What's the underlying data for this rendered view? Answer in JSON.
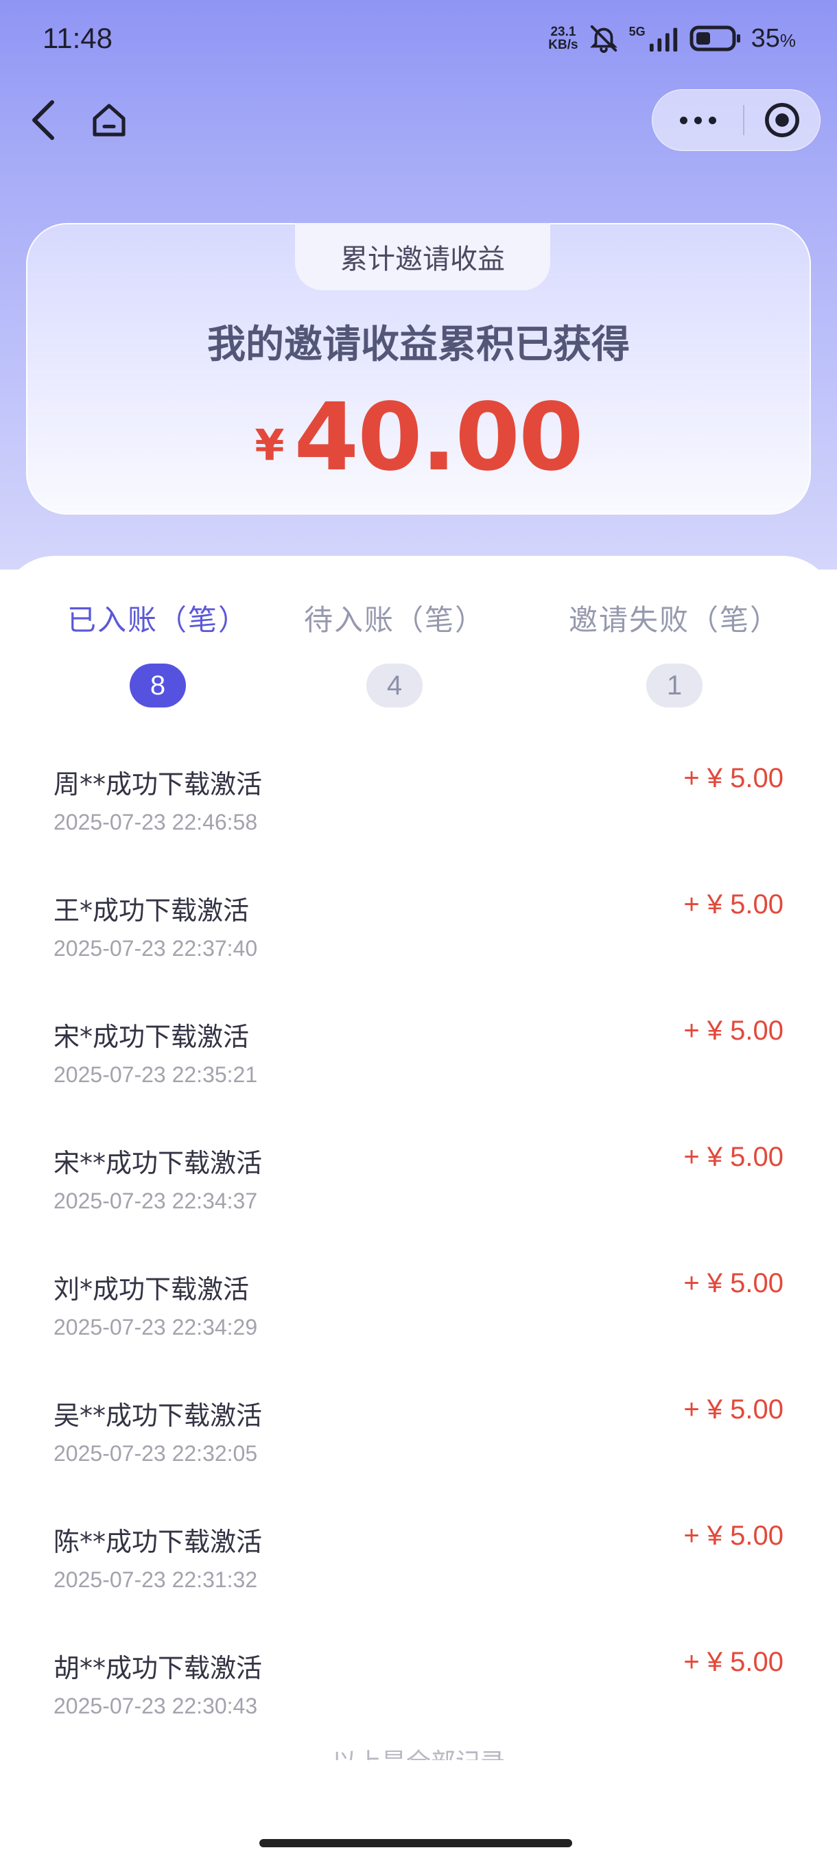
{
  "status_bar": {
    "time": "11:48",
    "net_speed_value": "23.1",
    "net_speed_unit": "KB/s",
    "network_type": "5G",
    "battery_percent": "35",
    "battery_unit": "%",
    "icons": [
      "bell-muted-icon",
      "signal-icon",
      "battery-icon"
    ]
  },
  "nav": {
    "back_icon": "chevron-left-icon",
    "home_icon": "home-icon",
    "more_icon": "more-dots-icon",
    "close_icon": "target-circle-icon"
  },
  "earnings_card": {
    "tag": "累计邀请收益",
    "subtitle": "我的邀请收益累积已获得",
    "currency": "¥",
    "amount": "40.00"
  },
  "tabs": [
    {
      "label": "已入账（笔）",
      "count": "8",
      "active": true
    },
    {
      "label": "待入账（笔）",
      "count": "4",
      "active": false
    },
    {
      "label": "邀请失败（笔）",
      "count": "1",
      "active": false
    }
  ],
  "records": [
    {
      "title": "周**成功下载激活",
      "time": "2025-07-23 22:46:58",
      "amount": "+ ¥ 5.00"
    },
    {
      "title": "王*成功下载激活",
      "time": "2025-07-23 22:37:40",
      "amount": "+ ¥ 5.00"
    },
    {
      "title": "宋*成功下载激活",
      "time": "2025-07-23 22:35:21",
      "amount": "+ ¥ 5.00"
    },
    {
      "title": "宋**成功下载激活",
      "time": "2025-07-23 22:34:37",
      "amount": "+ ¥ 5.00"
    },
    {
      "title": "刘*成功下载激活",
      "time": "2025-07-23 22:34:29",
      "amount": "+ ¥ 5.00"
    },
    {
      "title": "吴**成功下载激活",
      "time": "2025-07-23 22:32:05",
      "amount": "+ ¥ 5.00"
    },
    {
      "title": "陈**成功下载激活",
      "time": "2025-07-23 22:31:32",
      "amount": "+ ¥ 5.00"
    },
    {
      "title": "胡**成功下载激活",
      "time": "2025-07-23 22:30:43",
      "amount": "+ ¥ 5.00"
    }
  ],
  "footer_note": "以上是全部记录",
  "colors": {
    "accent": "#5552e0",
    "amount_red": "#e2493b",
    "header_gradient_top": "#8f95f4"
  }
}
